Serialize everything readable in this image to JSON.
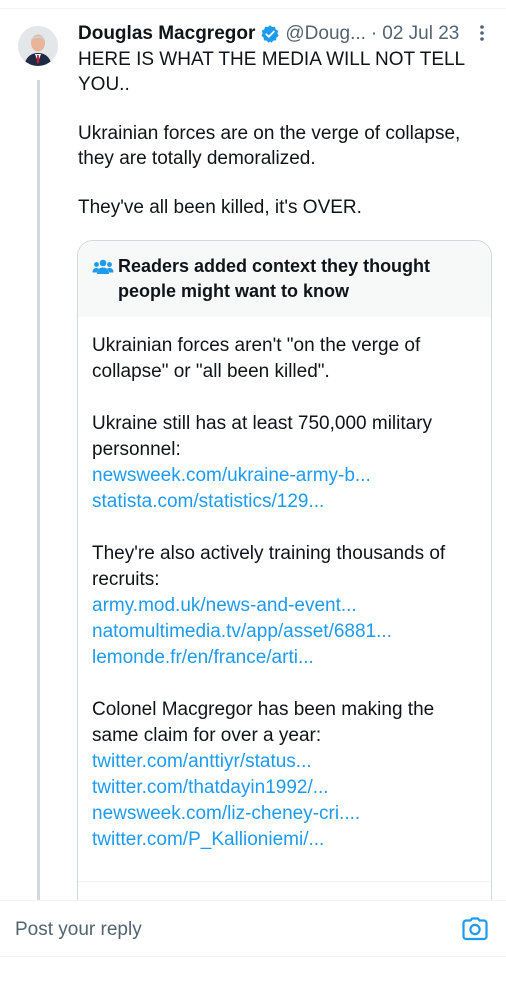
{
  "tweet": {
    "author_name": "Douglas Macgregor",
    "handle": "@Doug...",
    "separator": "·",
    "timestamp": "02 Jul 23",
    "more_icon": "more-vertical-icon",
    "verified_icon": "verified-badge-icon",
    "paragraphs": [
      "HERE IS WHAT THE MEDIA WILL NOT TELL YOU..",
      "Ukrainian forces are on the verge of collapse, they are totally demoralized.",
      "They've all been killed, it's OVER."
    ]
  },
  "community_note": {
    "icon": "people-icon",
    "title": "Readers added context they thought people might want to know",
    "intro": "Ukrainian forces aren't \"on the verge of collapse\" or \"all been killed\".",
    "section1_text": "Ukraine still has at least 750,000 military personnel:",
    "section1_links": [
      "newsweek.com/ukraine-army-b...",
      "statista.com/statistics/129..."
    ],
    "section2_text": "They're also actively training thousands of recruits:",
    "section2_links": [
      "army.mod.uk/news-and-event...",
      "natomultimedia.tv/app/asset/6881...",
      "lemonde.fr/en/france/arti..."
    ],
    "section3_text": "Colonel Macgregor has been making the same claim for over a year:",
    "section3_links": [
      "twitter.com/anttiyr/status...",
      "twitter.com/thatdayin1992/...",
      "newsweek.com/liz-cheney-cri....",
      "twitter.com/P_Kallioniemi/..."
    ]
  },
  "reply": {
    "placeholder": "Post your reply",
    "camera_icon": "camera-icon"
  },
  "colors": {
    "link": "#1d9bf0",
    "secondary_text": "#536471",
    "border": "#cfd9de"
  }
}
